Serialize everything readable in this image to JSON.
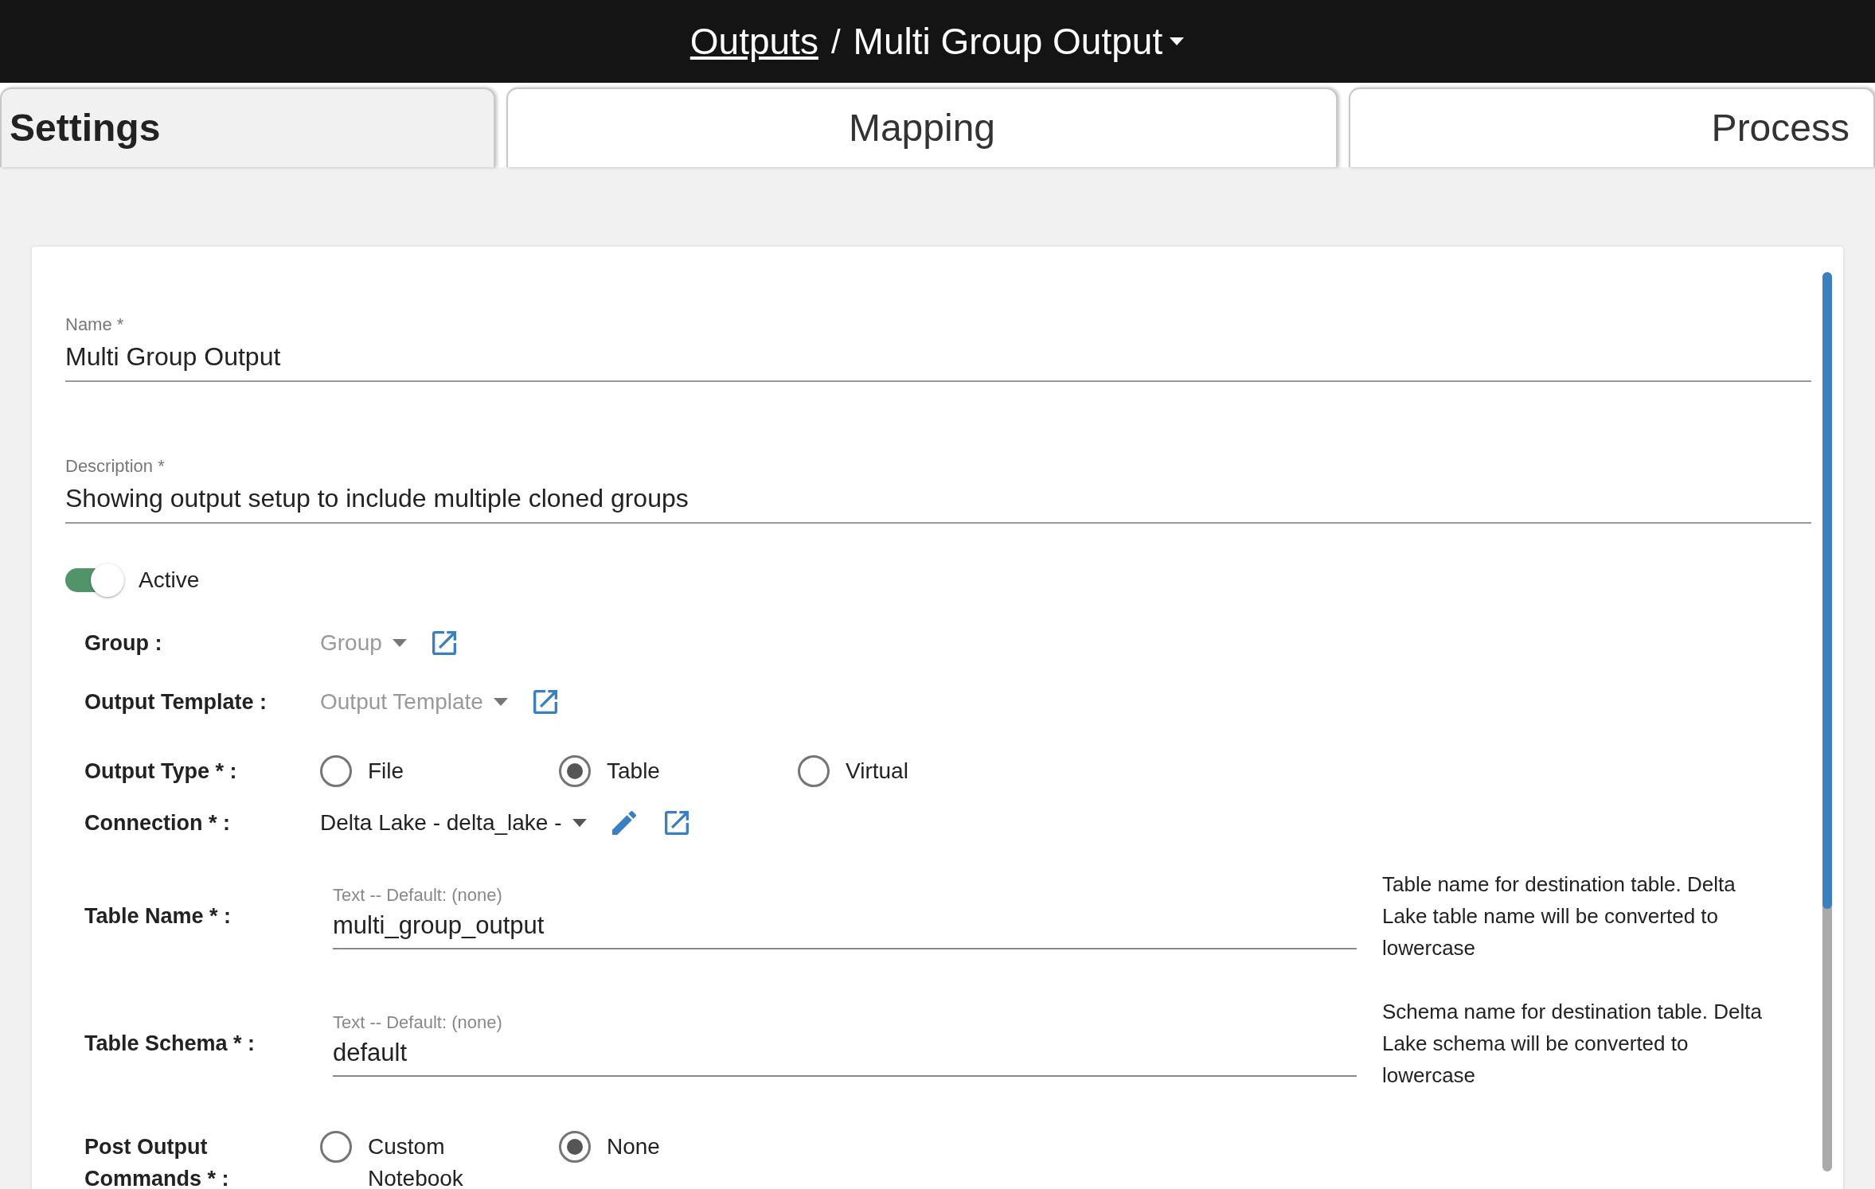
{
  "breadcrumb": {
    "link": "Outputs",
    "separator": "/",
    "current": "Multi Group Output"
  },
  "tabs": [
    {
      "label": "Settings",
      "selected": true
    },
    {
      "label": "Mapping",
      "selected": false
    },
    {
      "label": "Process",
      "selected": false
    }
  ],
  "fields": [
    {
      "label": "Name *",
      "value": "Multi Group Output"
    },
    {
      "label": "Description *",
      "value": "Showing output setup to include multiple cloned groups"
    }
  ],
  "active_toggle": {
    "label": "Active",
    "on": true
  },
  "rows": [
    {
      "kind": "select",
      "label": "Group :",
      "placeholder": "Group",
      "editable": false
    },
    {
      "kind": "select",
      "label": "Output Template :",
      "placeholder": "Output Template",
      "editable": false
    },
    {
      "kind": "radio",
      "label": "Output Type * :",
      "options": [
        {
          "label": "File",
          "selected": false
        },
        {
          "label": "Table",
          "selected": true
        },
        {
          "label": "Virtual",
          "selected": false
        }
      ]
    },
    {
      "kind": "select",
      "label": "Connection * :",
      "value": "Delta Lake - delta_lake -",
      "editable": true
    },
    {
      "kind": "text",
      "label": "Table Name * :",
      "placeholder": "Text -- Default: (none)",
      "value": "multi_group_output",
      "help": "Table name for destination table. Delta Lake table name will be converted to lowercase"
    },
    {
      "kind": "text",
      "label": "Table Schema * :",
      "placeholder": "Text -- Default: (none)",
      "value": "default",
      "help": "Schema name for destination table. Delta Lake schema will be converted to lowercase"
    },
    {
      "kind": "radio",
      "label": "Post Output Commands * :",
      "options": [
        {
          "label": "Custom Notebook",
          "selected": false
        },
        {
          "label": "None",
          "selected": true
        }
      ]
    }
  ]
}
